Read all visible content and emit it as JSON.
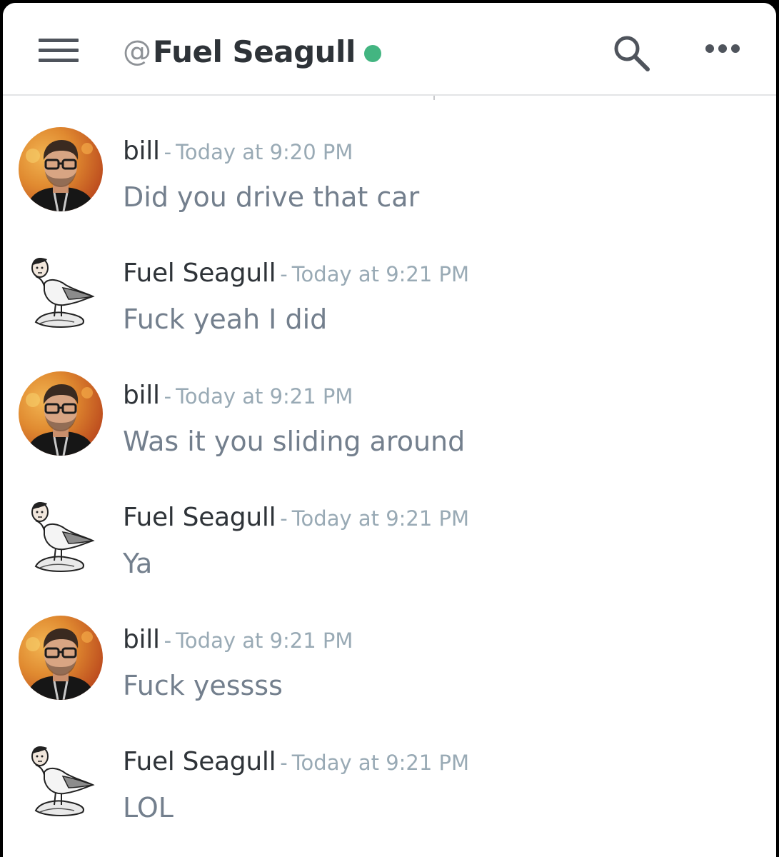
{
  "header": {
    "at_symbol": "@",
    "channel_name": "Fuel Seagull",
    "status": "online",
    "status_color": "#43b581",
    "menu_icon": "hamburger-menu-icon",
    "search_icon": "search-icon",
    "more_icon": "more-dots-icon"
  },
  "messages": [
    {
      "author": "bill",
      "separator": "-",
      "timestamp": "Today at 9:20 PM",
      "content": "Did you drive that car",
      "avatar": "bill-avatar"
    },
    {
      "author": "Fuel Seagull",
      "separator": "-",
      "timestamp": "Today at 9:21 PM",
      "content": "Fuck yeah I did",
      "avatar": "seagull-avatar"
    },
    {
      "author": "bill",
      "separator": "-",
      "timestamp": "Today at 9:21 PM",
      "content": "Was it you sliding around",
      "avatar": "bill-avatar"
    },
    {
      "author": "Fuel Seagull",
      "separator": "-",
      "timestamp": "Today at 9:21 PM",
      "content": "Ya",
      "avatar": "seagull-avatar"
    },
    {
      "author": "bill",
      "separator": "-",
      "timestamp": "Today at 9:21 PM",
      "content": "Fuck yessss",
      "avatar": "bill-avatar"
    },
    {
      "author": "Fuel Seagull",
      "separator": "-",
      "timestamp": "Today at 9:21 PM",
      "content": "LOL",
      "avatar": "seagull-avatar"
    }
  ]
}
